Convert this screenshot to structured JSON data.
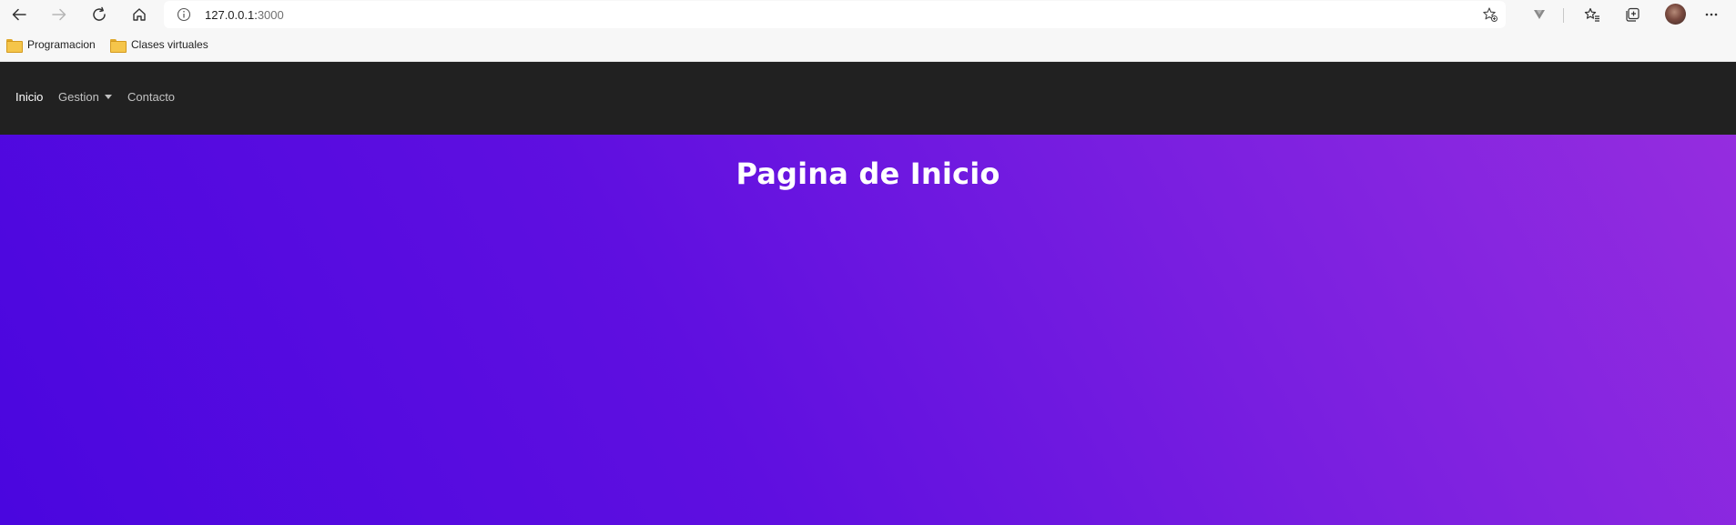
{
  "browser": {
    "address": {
      "host": "127.0.0.1:",
      "port": "3000"
    },
    "toolbar_icons": [
      "back-arrow-icon",
      "forward-arrow-icon",
      "refresh-icon",
      "home-icon",
      "site-info-icon",
      "add-favorite-icon",
      "extension-icon",
      "favorites-icon",
      "collections-icon",
      "profile-avatar",
      "more-menu-icon"
    ]
  },
  "bookmarks": [
    {
      "label": "Programacion",
      "icon": "folder-icon"
    },
    {
      "label": "Clases virtuales",
      "icon": "folder-icon"
    }
  ],
  "navbar": {
    "items": [
      {
        "label": "Inicio",
        "active": true
      },
      {
        "label": "Gestion",
        "dropdown": true
      },
      {
        "label": "Contacto"
      }
    ]
  },
  "hero": {
    "title": "Pagina de Inicio",
    "gradient": [
      "#4a06df",
      "#952ddf"
    ]
  },
  "colors": {
    "navbar_bg": "#212121",
    "toolbar_bg": "#f7f7f7"
  }
}
